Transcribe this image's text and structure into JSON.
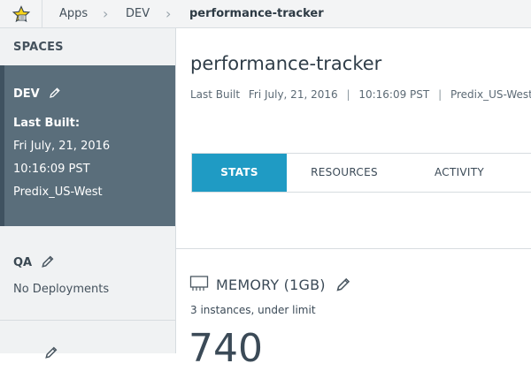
{
  "breadcrumb": {
    "items": [
      "Apps",
      "DEV"
    ],
    "current": "performance-tracker"
  },
  "sidebar": {
    "heading": "SPACES",
    "active_space": {
      "name": "DEV",
      "last_built_label": "Last Built:",
      "date": "Fri July, 21, 2016",
      "time": "10:16:09 PST",
      "region": "Predix_US-West"
    },
    "spaces": [
      {
        "name": "QA",
        "status": "No Deployments"
      }
    ]
  },
  "main": {
    "title": "performance-tracker",
    "meta": {
      "label": "Last Built",
      "date": "Fri July, 21, 2016",
      "time": "10:16:09 PST",
      "region": "Predix_US-West"
    },
    "tabs": [
      {
        "label": "STATS",
        "active": true
      },
      {
        "label": "RESOURCES",
        "active": false
      },
      {
        "label": "ACTIVITY",
        "active": false
      }
    ],
    "memory": {
      "title": "MEMORY (1GB)",
      "subtitle": "3 instances, under limit",
      "value": "740"
    }
  },
  "icons": {
    "favorite": "star-icon",
    "edit": "pencil-icon",
    "memory": "memory-chip-icon"
  },
  "colors": {
    "accent": "#1f9bc4",
    "sidebar_active": "#5a6e7b"
  }
}
